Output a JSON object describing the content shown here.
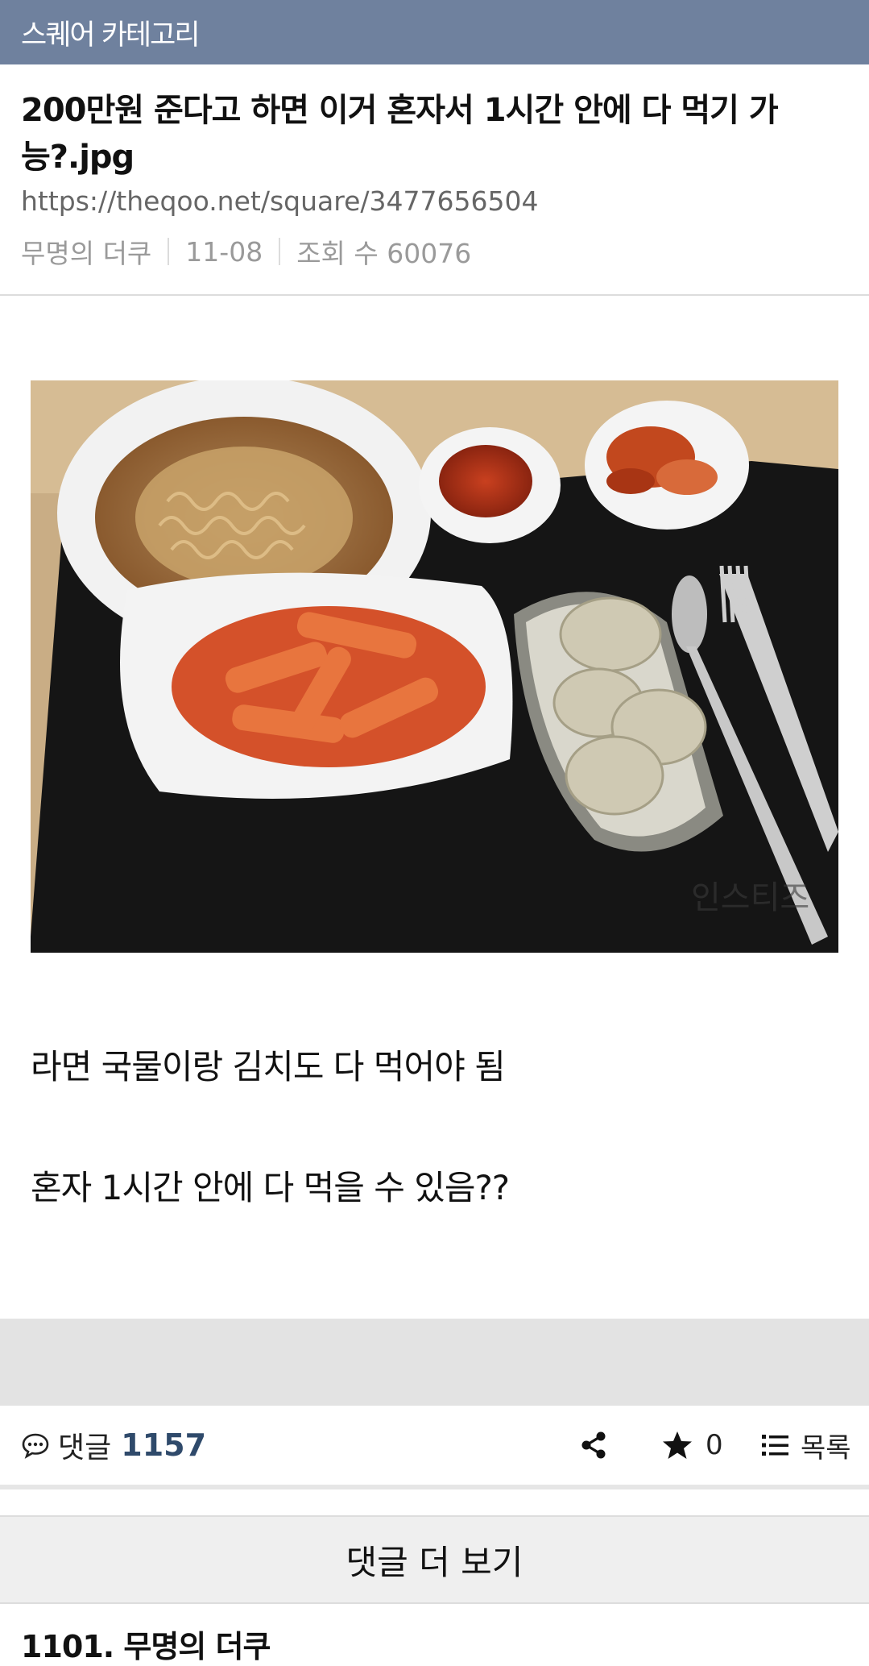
{
  "topbar": {
    "category_label": "스퀘어 카테고리"
  },
  "post": {
    "title": "200만원 준다고 하면 이거 혼자서 1시간 안에 다 먹기 가능?.jpg",
    "url": "https://theqoo.net/square/3477656504",
    "author": "무명의 더쿠",
    "date": "11-08",
    "views_label": "조회 수 60076",
    "image_watermark": "인스티즈",
    "body_lines": [
      "라면 국물이랑 김치도 다 먹어야 됨",
      "혼자 1시간 안에 다 먹을 수 있음??"
    ]
  },
  "actions": {
    "comment_label": "댓글",
    "comment_count": "1157",
    "star_count": "0",
    "list_label": "목록"
  },
  "more_comments_label": "댓글 더 보기",
  "next_comment_peek": "1101. 무명의 더쿠",
  "colors": {
    "topbar": "#6f819e",
    "comment_count": "#2f4a6b"
  }
}
